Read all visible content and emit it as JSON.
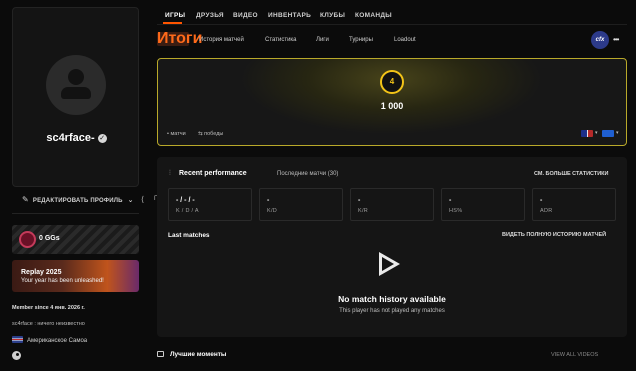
{
  "profile": {
    "username": "sc4rface-",
    "edit_label": "РЕДАКТИРОВАТЬ ПРОФИЛЬ",
    "share_label": "Г",
    "ggs": "0 GGs",
    "replay": {
      "title": "Replay 2025",
      "subtitle": "Your year has been unleashed!"
    },
    "member_since": "Member since 4 янв. 2026 г.",
    "bio": "sc4rface : ничего неизвестно",
    "country": "Американское Самоа"
  },
  "nav": {
    "items": [
      "ИГРЫ",
      "ДРУЗЬЯ",
      "ВИДЕО",
      "ИНВЕНТАРЬ",
      "КЛУБЫ",
      "КОМАНДЫ"
    ]
  },
  "tabs": [
    "Итоги",
    "История матчей",
    "Статистика",
    "Лиги",
    "Турниры",
    "Loadout"
  ],
  "game_logo": "cfx",
  "elo": {
    "level": "4",
    "value": "1 000",
    "filter_matches": "матчи",
    "filter_wins": "победы",
    "ring_color": "#f2c318"
  },
  "performance": {
    "title": "Recent performance",
    "subtitle": "Последние матчи (30)",
    "more_link": "СМ. БОЛЬШЕ СТАТИСТИКИ",
    "stats": [
      {
        "value": "- / - / -",
        "label": "K / D / A"
      },
      {
        "value": "-",
        "label": "K/D"
      },
      {
        "value": "-",
        "label": "K/R"
      },
      {
        "value": "-",
        "label": "HS%"
      },
      {
        "value": "-",
        "label": "ADR"
      }
    ]
  },
  "last_matches": {
    "title": "Last matches",
    "history_link": "ВИДЕТЬ ПОЛНУЮ ИСТОРИЮ МАТЧЕЙ",
    "empty_title": "No match history available",
    "empty_subtitle": "This player has not played any matches"
  },
  "highlights": {
    "title": "Лучшие моменты",
    "view_all": "VIEW ALL VIDEOS"
  },
  "colors": {
    "accent": "#ff5500",
    "card_border": "#b9a92a"
  }
}
